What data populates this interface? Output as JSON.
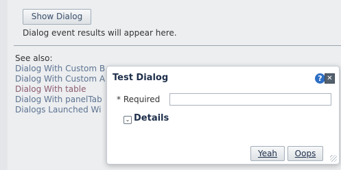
{
  "main": {
    "show_dialog_label": "Show Dialog",
    "result_text": "Dialog event results will appear here."
  },
  "see_also": {
    "title": "See also:",
    "links": [
      "Dialog With Custom B",
      "Dialog With Custom A",
      "Dialog With table",
      "Dialog With panelTab",
      "Dialogs Launched Wi"
    ]
  },
  "dialog": {
    "title": "Test Dialog",
    "help_glyph": "?",
    "close_glyph": "✕",
    "required_label": "* Required",
    "required_value": "",
    "details_label": "Details",
    "yeah_label": "Yeah",
    "oops_label": "Oops"
  }
}
